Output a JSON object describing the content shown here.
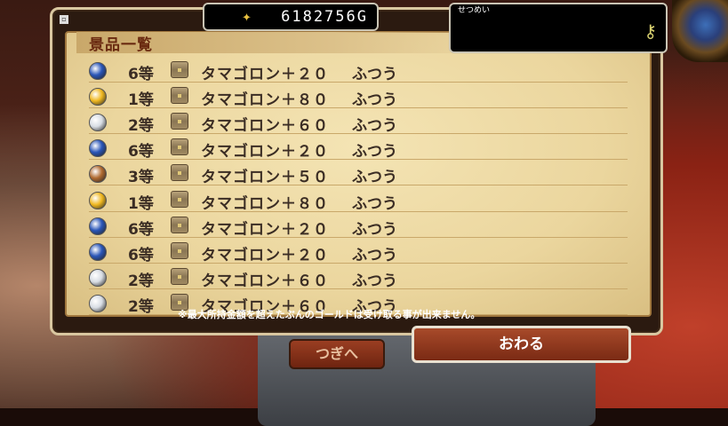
{
  "gold": {
    "value": "6182756G",
    "icon": "coin-pile-icon"
  },
  "description": {
    "label": "せつめい",
    "icon": "key-icon"
  },
  "panel": {
    "title": "景品一覧"
  },
  "prizes": [
    {
      "rank": "6等",
      "item": "タマゴロン＋２０",
      "quality": "ふつう",
      "orb": "blue"
    },
    {
      "rank": "1等",
      "item": "タマゴロン＋８０",
      "quality": "ふつう",
      "orb": "gold"
    },
    {
      "rank": "2等",
      "item": "タマゴロン＋６０",
      "quality": "ふつう",
      "orb": "silver"
    },
    {
      "rank": "6等",
      "item": "タマゴロン＋２０",
      "quality": "ふつう",
      "orb": "blue"
    },
    {
      "rank": "3等",
      "item": "タマゴロン＋５０",
      "quality": "ふつう",
      "orb": "bronze"
    },
    {
      "rank": "1等",
      "item": "タマゴロン＋８０",
      "quality": "ふつう",
      "orb": "gold"
    },
    {
      "rank": "6等",
      "item": "タマゴロン＋２０",
      "quality": "ふつう",
      "orb": "blue"
    },
    {
      "rank": "6等",
      "item": "タマゴロン＋２０",
      "quality": "ふつう",
      "orb": "blue"
    },
    {
      "rank": "2等",
      "item": "タマゴロン＋６０",
      "quality": "ふつう",
      "orb": "silver"
    },
    {
      "rank": "2等",
      "item": "タマゴロン＋６０",
      "quality": "ふつう",
      "orb": "silver"
    }
  ],
  "orb_colors": {
    "blue": "#2a56b8",
    "gold": "#f0b820",
    "silver": "#d8dde4",
    "bronze": "#b06a30"
  },
  "note": "※最大所持金額を超えたぶんのゴールドは受け取る事が出来ません。",
  "buttons": {
    "next": "つぎへ",
    "close": "おわる"
  }
}
